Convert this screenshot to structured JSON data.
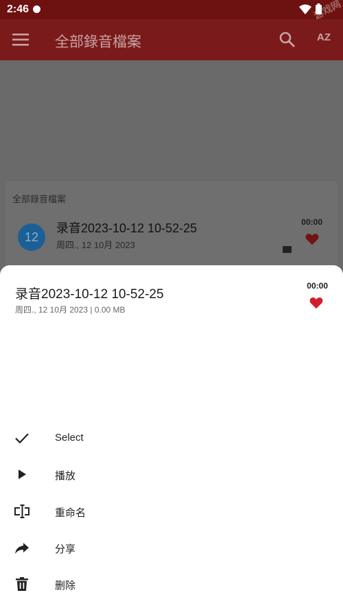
{
  "status_bar": {
    "time": "2:46",
    "watermark": "游戏网"
  },
  "app_bar": {
    "title": "全部錄音檔案",
    "sort_label": "AZ"
  },
  "list": {
    "header": "全部錄音檔案",
    "item": {
      "avatar_text": "12",
      "title": "录音2023-10-12 10-52-25",
      "date": "周四., 12 10月 2023",
      "duration": "00:00",
      "favorite": true
    }
  },
  "sheet": {
    "title": "录音2023-10-12 10-52-25",
    "subtitle": "周四., 12 10月 2023 | 0.00 MB",
    "duration": "00:00",
    "favorite": true,
    "actions": [
      {
        "label": "Select",
        "icon": "check-icon"
      },
      {
        "label": "播放",
        "icon": "play-icon"
      },
      {
        "label": "重命名",
        "icon": "rename-icon"
      },
      {
        "label": "分享",
        "icon": "share-icon"
      },
      {
        "label": "删除",
        "icon": "delete-icon"
      }
    ]
  },
  "colors": {
    "primary": "#b92b27",
    "scrim_appbar": "#7a1a1a",
    "heart": "#d11f2b",
    "avatar": "#1c5f96"
  }
}
